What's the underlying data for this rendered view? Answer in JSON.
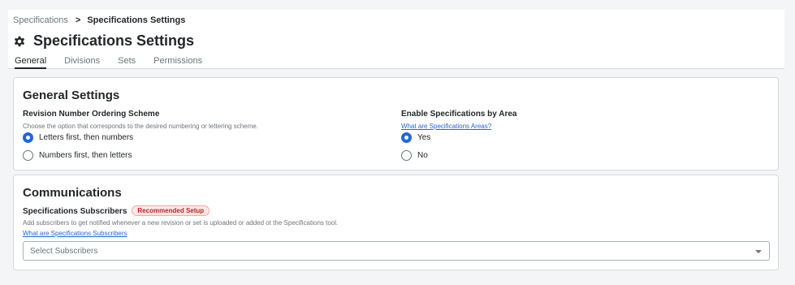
{
  "breadcrumb": {
    "root": "Specifications",
    "separator": ">",
    "current": "Specifications Settings"
  },
  "page": {
    "title": "Specifications Settings",
    "icon": "gear-icon"
  },
  "tabs": [
    {
      "label": "General",
      "active": true
    },
    {
      "label": "Divisions",
      "active": false
    },
    {
      "label": "Sets",
      "active": false
    },
    {
      "label": "Permissions",
      "active": false
    }
  ],
  "general": {
    "title": "General Settings",
    "ordering": {
      "label": "Revision Number Ordering Scheme",
      "hint": "Choose the option that corresponds to the desired numbering or lettering scheme.",
      "options": [
        {
          "label": "Letters first, then numbers",
          "selected": true
        },
        {
          "label": "Numbers first, then letters",
          "selected": false
        }
      ]
    },
    "area": {
      "label": "Enable Specifications by Area",
      "link": "What are Specifications Areas?",
      "options": [
        {
          "label": "Yes",
          "selected": true
        },
        {
          "label": "No",
          "selected": false
        }
      ]
    }
  },
  "communications": {
    "title": "Communications",
    "subscribers_label": "Specifications Subscribers",
    "badge": "Recommended Setup",
    "hint": "Add subscribers to get notified whenever a new revision or set is uploaded or added ot the Specifications tool.",
    "link": "What are Specifications Subscribers",
    "select_placeholder": "Select Subscribers"
  },
  "colors": {
    "accent": "#2066df",
    "badge_text": "#c0221e",
    "badge_bg": "#fde8e6"
  }
}
